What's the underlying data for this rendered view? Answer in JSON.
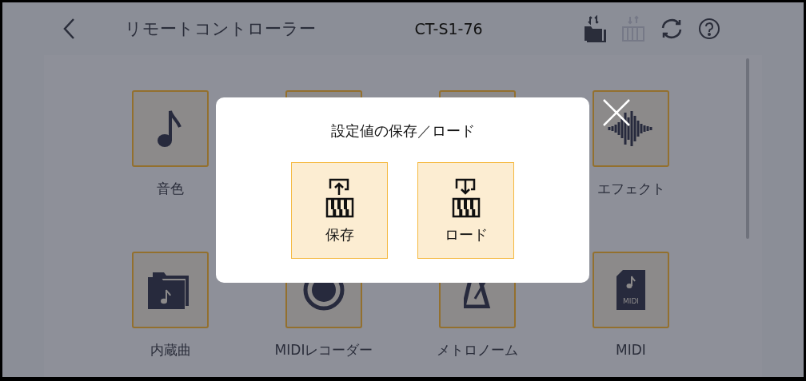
{
  "header": {
    "title": "リモートコントローラー",
    "model": "CT-S1-76",
    "tools": [
      {
        "kind": "folder-transfer",
        "disabled": false
      },
      {
        "kind": "piano-transfer",
        "disabled": true
      },
      {
        "kind": "sync",
        "disabled": false
      },
      {
        "kind": "help",
        "disabled": false
      }
    ]
  },
  "tiles": [
    {
      "kind": "note",
      "label": "音色"
    },
    {
      "kind": "hidden"
    },
    {
      "kind": "hidden"
    },
    {
      "kind": "wave",
      "label": "エフェクト"
    },
    {
      "kind": "folder",
      "label": "内蔵曲"
    },
    {
      "kind": "record",
      "label": "MIDIレコーダー"
    },
    {
      "kind": "metronome",
      "label": "メトロノーム"
    },
    {
      "kind": "midi-file",
      "label": "MIDI",
      "icon_text": "MIDI"
    }
  ],
  "dialog": {
    "title": "設定値の保存／ロード",
    "buttons": [
      {
        "kind": "save",
        "label": "保存"
      },
      {
        "kind": "load",
        "label": "ロード"
      }
    ]
  }
}
